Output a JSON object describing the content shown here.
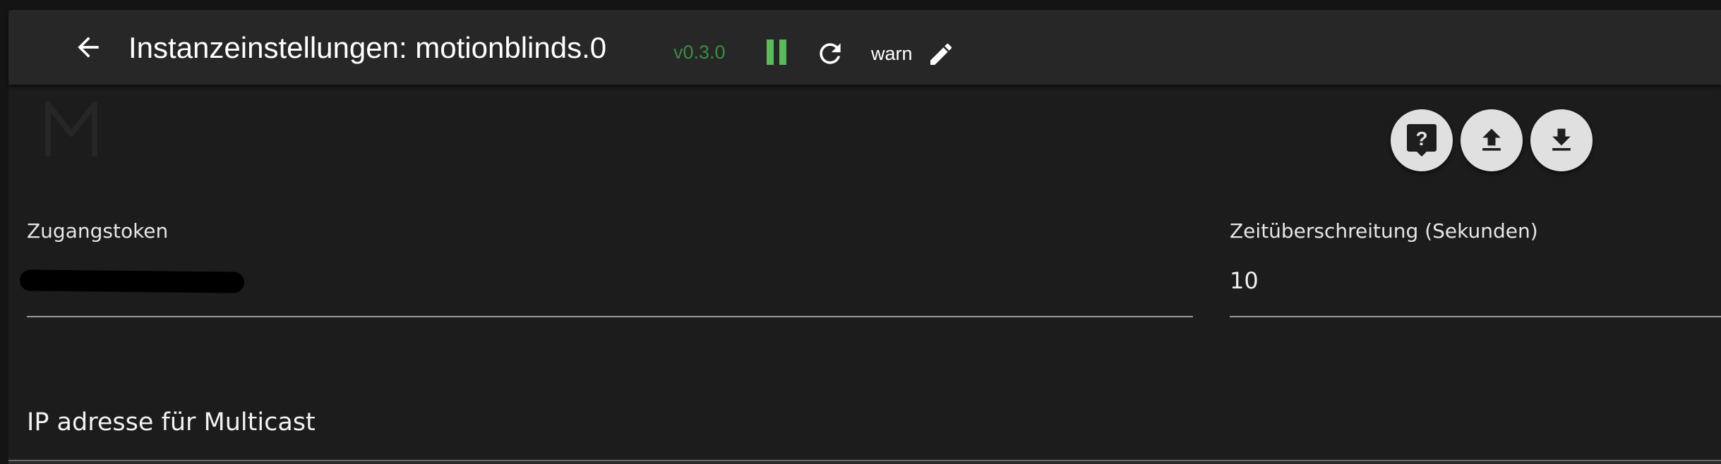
{
  "header": {
    "title": "Instanzeinstellungen: motionblinds.0",
    "version": "v0.3.0",
    "log_level": "warn",
    "back_icon": "arrow-left-icon",
    "pause_icon": "pause-icon",
    "reload_icon": "reload-icon",
    "edit_icon": "pencil-icon",
    "version_color": "#3f8a42",
    "pause_color": "#5cb85c"
  },
  "actions": {
    "help_icon": "help-icon",
    "upload_icon": "upload-icon",
    "download_icon": "download-icon"
  },
  "form": {
    "token": {
      "label": "Zugangstoken",
      "value": ""
    },
    "timeout": {
      "label": "Zeitüberschreitung (Sekunden)",
      "value": "10"
    },
    "multicast_section": {
      "title": "IP adresse für Multicast"
    }
  }
}
